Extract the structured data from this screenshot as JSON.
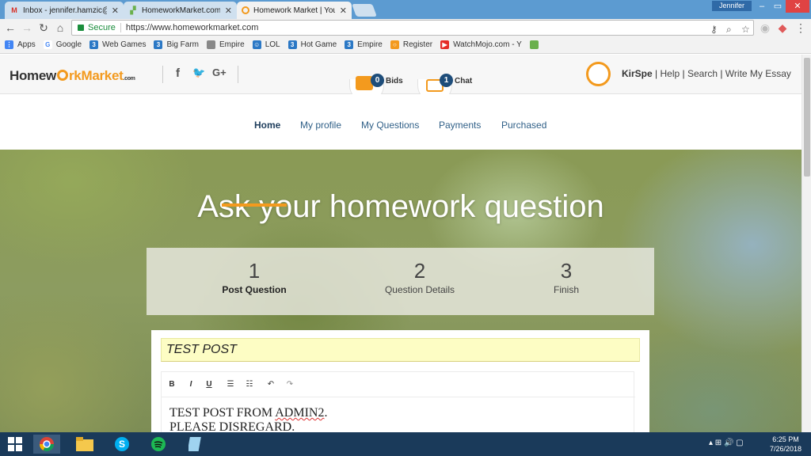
{
  "browser": {
    "tabs": [
      {
        "title": "Inbox - jennifer.hamzic@",
        "icon": "gmail-icon",
        "active": false
      },
      {
        "title": "HomeworkMarket.com -",
        "icon": "homeworkmarket-icon",
        "active": false
      },
      {
        "title": "Homework Market | Your",
        "icon": "homeworkmarket-icon",
        "active": true
      }
    ],
    "profile_name": "Jennifer",
    "window_controls": {
      "minimize": "–",
      "restore": "▭",
      "close": "✕"
    },
    "secure_label": "Secure",
    "url": "https://www.homeworkmarket.com",
    "bookmarks": [
      {
        "label": "Apps",
        "color": "#4285f4",
        "glyph": "⋮"
      },
      {
        "label": "Google",
        "color": "#ffffff",
        "glyph": "G"
      },
      {
        "label": "Web Games",
        "color": "#2b78c5",
        "glyph": "3"
      },
      {
        "label": "Big Farm",
        "color": "#2b78c5",
        "glyph": "3"
      },
      {
        "label": "Empire",
        "color": "#888888",
        "glyph": ""
      },
      {
        "label": "LOL",
        "color": "#2b78c5",
        "glyph": "☺"
      },
      {
        "label": "Hot Game",
        "color": "#2b78c5",
        "glyph": "3"
      },
      {
        "label": "Empire",
        "color": "#2b78c5",
        "glyph": "3"
      },
      {
        "label": "Register",
        "color": "#f39a1e",
        "glyph": "○"
      },
      {
        "label": "WatchMojo.com - Y",
        "color": "#e52d27",
        "glyph": "▶"
      }
    ]
  },
  "site": {
    "logo": {
      "part1": "Homew",
      "part2": "rk",
      "part3": "Market",
      "suffix": ".com"
    },
    "social": [
      "f",
      "🐦",
      "G+"
    ],
    "bids": {
      "count": "0",
      "label": "Bids"
    },
    "chat": {
      "count": "1",
      "label": "Chat"
    },
    "user": {
      "name": "KirSpe",
      "links": [
        "Help",
        "Search",
        "Write My Essay"
      ],
      "separator": " | "
    },
    "nav": [
      {
        "label": "Home",
        "active": true
      },
      {
        "label": "My profile",
        "active": false
      },
      {
        "label": "My Questions",
        "active": false
      },
      {
        "label": "Payments",
        "active": false
      },
      {
        "label": "Purchased",
        "active": false
      }
    ],
    "hero_title": "Ask your homework question",
    "steps": [
      {
        "number": "1",
        "label": "Post Question",
        "active": true
      },
      {
        "number": "2",
        "label": "Question Details",
        "active": false
      },
      {
        "number": "3",
        "label": "Finish",
        "active": false
      }
    ],
    "question_title": "TEST POST",
    "editor_tools": [
      "B",
      "I",
      "U",
      "bulleted-list",
      "numbered-list",
      "undo",
      "redo"
    ],
    "editor_body": [
      "TEST POST FROM ",
      "ADMIN2",
      ".",
      "PLEASE DISREGARD."
    ]
  },
  "taskbar": {
    "apps": [
      "windows-start-icon",
      "chrome-icon",
      "file-explorer-icon",
      "skype-icon",
      "spotify-icon",
      "notepad-icon"
    ],
    "time": "6:25 PM",
    "date": "7/26/2018"
  },
  "colors": {
    "accent": "#f39a1e",
    "nav_blue": "#1e4d7a",
    "chrome_blue": "#5c9bd1"
  }
}
